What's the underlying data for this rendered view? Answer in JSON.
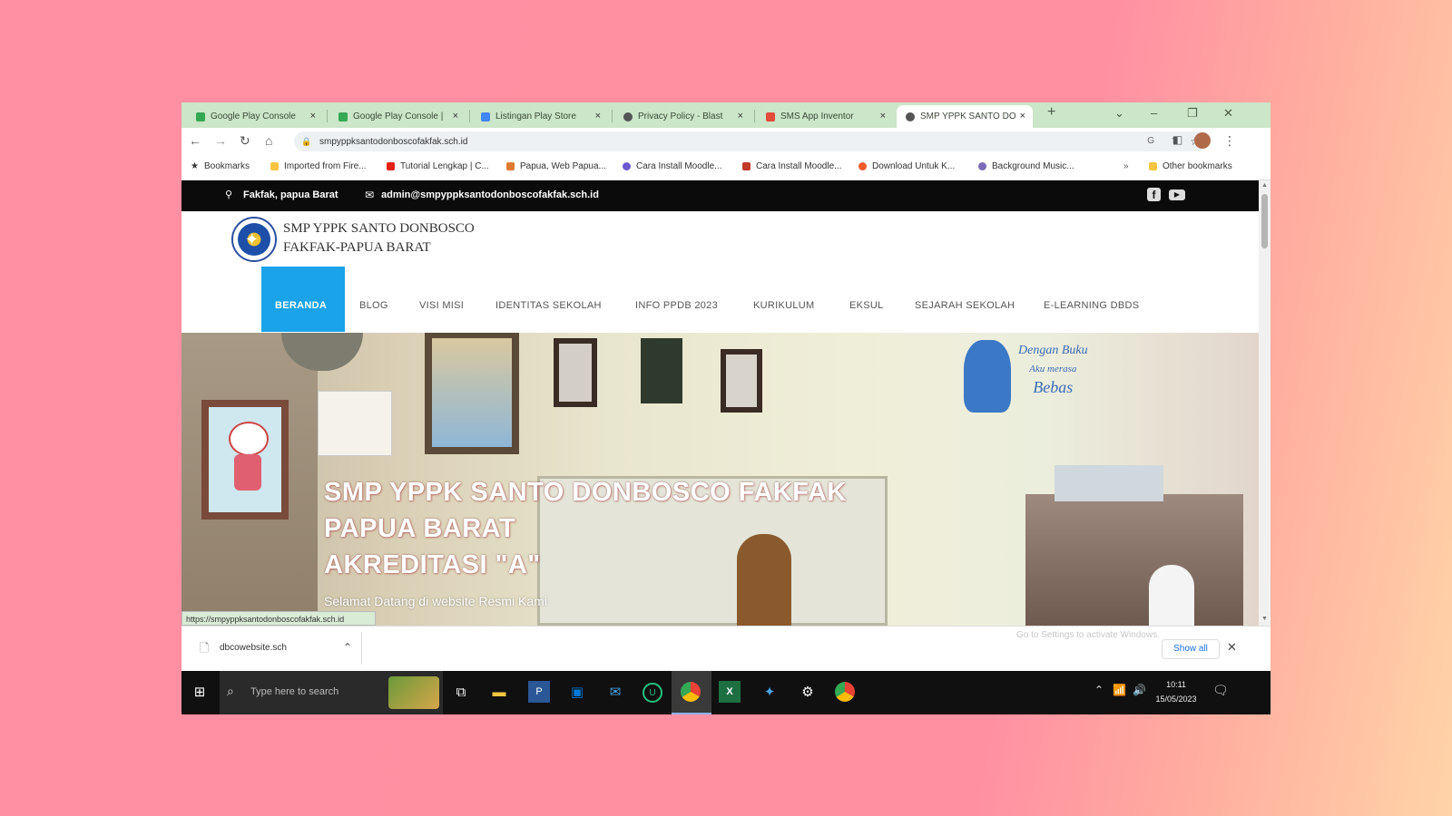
{
  "browser": {
    "tabs": [
      {
        "label": "Google Play Console",
        "favicon_color": "#34a853",
        "active": false
      },
      {
        "label": "Google Play Console |",
        "favicon_color": "#34a853",
        "active": false
      },
      {
        "label": "Listingan Play Store",
        "favicon_color": "#4285f4",
        "active": false
      },
      {
        "label": "Privacy Policy - Blast",
        "favicon_color": "#555555",
        "active": false
      },
      {
        "label": "SMS App Inventor",
        "favicon_color": "#e34b3b",
        "active": false
      },
      {
        "label": "SMP YPPK SANTO DO",
        "favicon_color": "#555555",
        "active": true
      }
    ],
    "new_tab_label": "+",
    "address": "smpyppksantodonboscofakfak.sch.id",
    "bookmarks": [
      {
        "label": "Bookmarks",
        "color": "#333333"
      },
      {
        "label": "Imported from Fire...",
        "color": "#f5c542"
      },
      {
        "label": "Tutorial Lengkap | C...",
        "color": "#e62117"
      },
      {
        "label": "Papua, Web Papua...",
        "color": "#e07a2e"
      },
      {
        "label": "Cara Install Moodle...",
        "color": "#6a5acd"
      },
      {
        "label": "Cara Install Moodle...",
        "color": "#c0392b"
      },
      {
        "label": "Download Untuk K...",
        "color": "#f05a28"
      },
      {
        "label": "Background Music...",
        "color": "#7a6ab8"
      }
    ],
    "other_bookmarks": "Other bookmarks",
    "status_url": "https://smpyppksantodonboscofakfak.sch.id"
  },
  "site": {
    "location": "Fakfak, papua Barat",
    "email": "admin@smpyppksantodonboscofakfak.sch.id",
    "school_name_line1": "SMP YPPK SANTO DONBOSCO",
    "school_name_line2": "FAKFAK-PAPUA BARAT",
    "nav": [
      {
        "label": "BERANDA",
        "active": true
      },
      {
        "label": "BLOG",
        "active": false
      },
      {
        "label": "VISI MISI",
        "active": false
      },
      {
        "label": "IDENTITAS SEKOLAH",
        "active": false
      },
      {
        "label": "INFO PPDB 2023",
        "active": false
      },
      {
        "label": "KURIKULUM",
        "active": false
      },
      {
        "label": "EKSUL",
        "active": false
      },
      {
        "label": "SEJARAH SEKOLAH",
        "active": false
      },
      {
        "label": "E-LEARNING DBDS",
        "active": false
      }
    ],
    "hero": {
      "title_line1": "SMP YPPK SANTO DONBOSCO FAKFAK",
      "title_line2": "PAPUA BARAT",
      "title_line3": "AKREDITASI \"A\"",
      "subtitle": "Selamat Datang di website Resmi Kami",
      "wall_text_line1": "Dengan Buku",
      "wall_text_line2": "Aku merasa",
      "wall_text_line3": "Bebas"
    },
    "accent_color": "#1aa3e8"
  },
  "downloads": {
    "file_name": "dbcowebsite.sch",
    "windows_watermark": "Go to Settings to activate Windows.",
    "show_all": "Show all"
  },
  "taskbar": {
    "search_placeholder": "Type here to search",
    "time": "10:11",
    "date": "15/05/2023"
  }
}
